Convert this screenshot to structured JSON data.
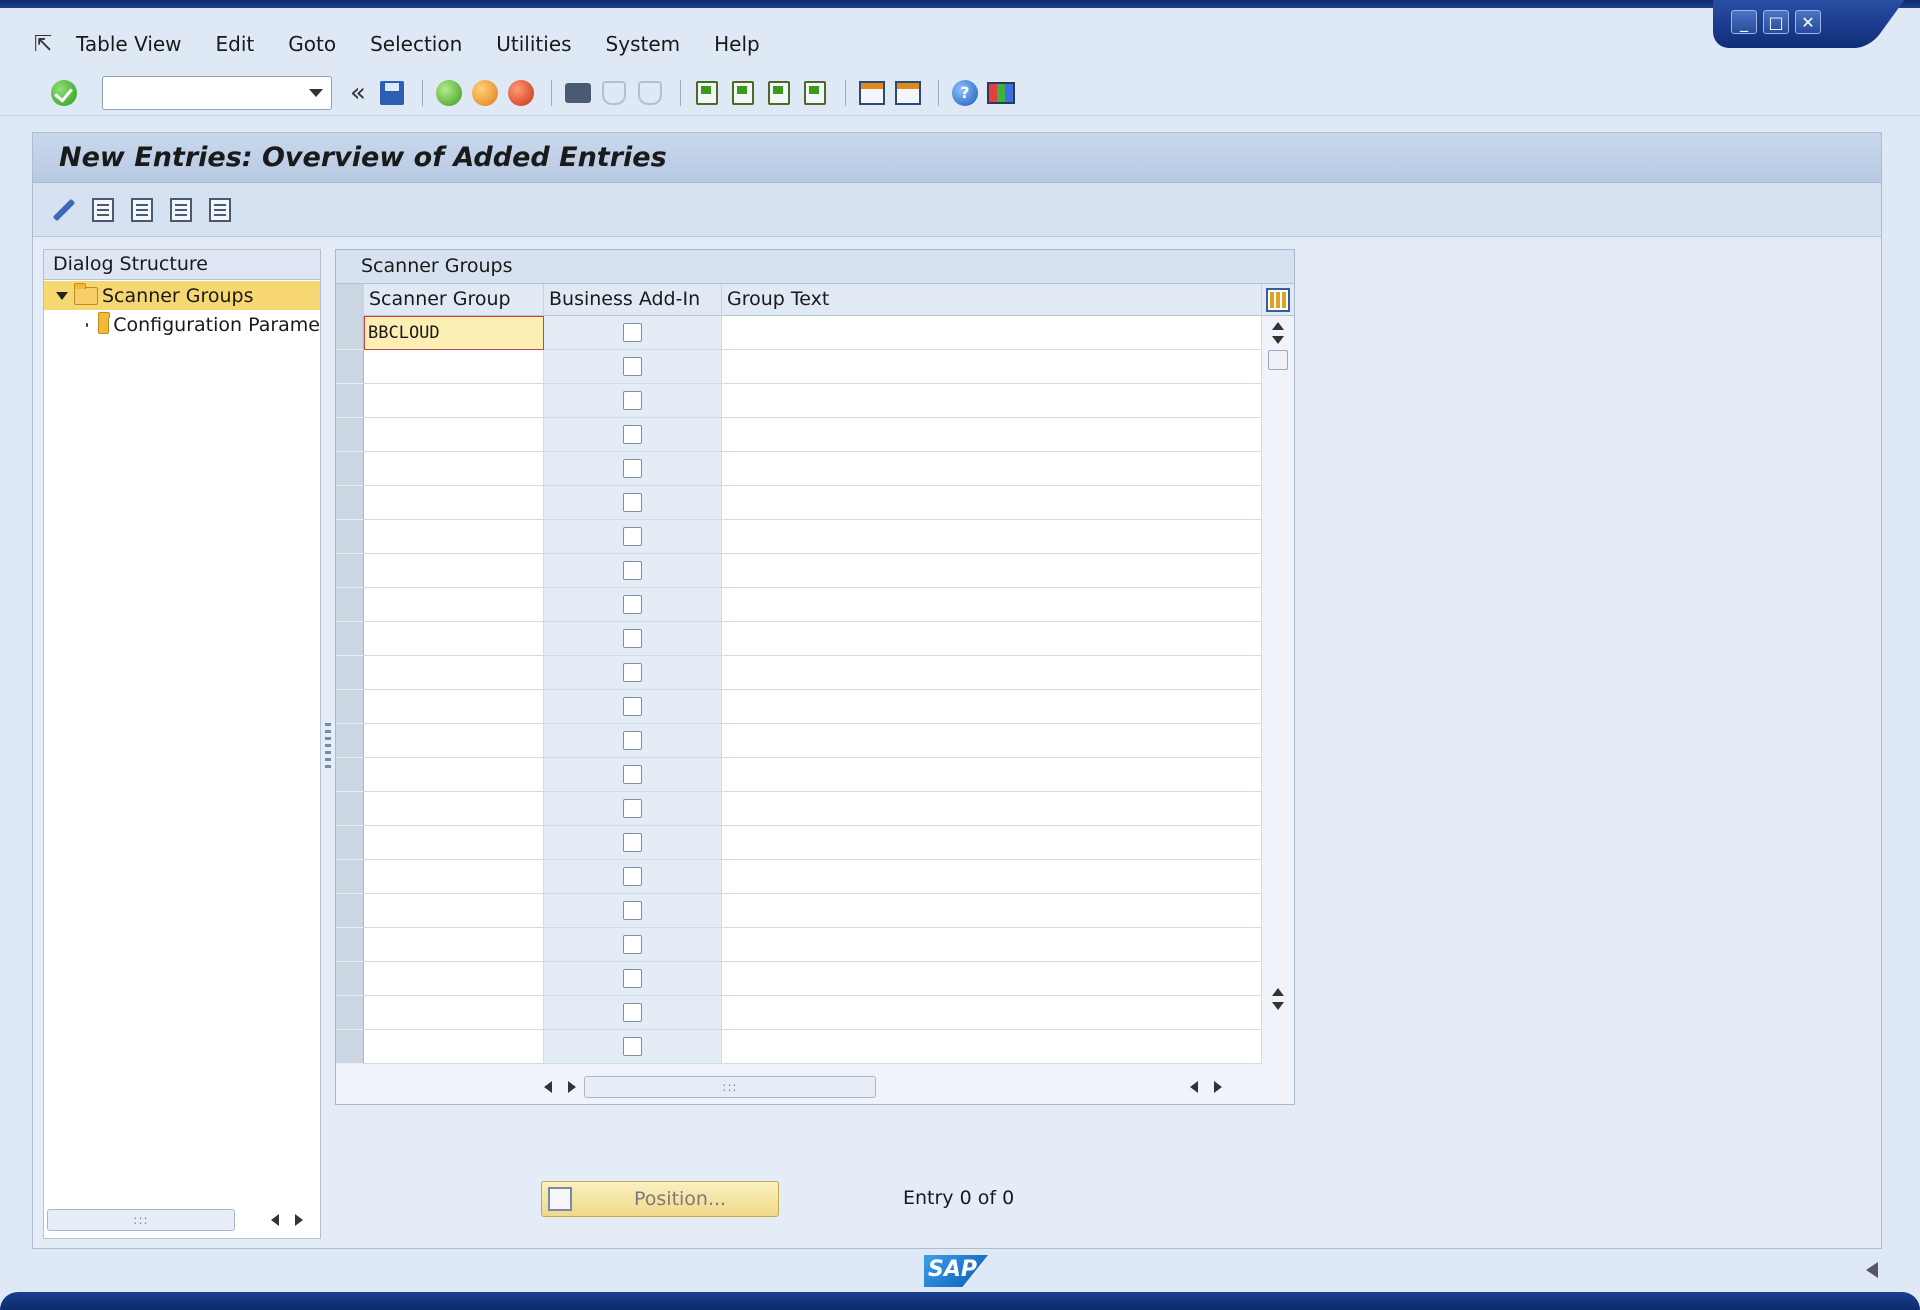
{
  "menu": {
    "items": [
      "Table View",
      "Edit",
      "Goto",
      "Selection",
      "Utilities",
      "System",
      "Help"
    ]
  },
  "window": {
    "minimize": "_",
    "maximize": "□",
    "close": "✕"
  },
  "toolbar": {
    "command_field_value": "",
    "back_chevron": "«"
  },
  "screen": {
    "title": "New Entries: Overview of Added Entries"
  },
  "dialog_structure": {
    "header": "Dialog Structure",
    "nodes": [
      {
        "label": "Scanner Groups",
        "selected": true
      },
      {
        "label": "Configuration Parame",
        "selected": false
      }
    ],
    "scroll_thumb": ":::"
  },
  "table": {
    "title": "Scanner Groups",
    "columns": [
      "Scanner Group",
      "Business Add-In",
      "Group Text"
    ],
    "first_row_value": "BBCLOUD",
    "row_count": 22,
    "scroll_thumb": ":::"
  },
  "footer": {
    "position_button": "Position...",
    "entry_info": "Entry 0 of 0",
    "logo_text": "SAP"
  },
  "colors": {
    "selected_node": "#f6d772",
    "active_cell": "#fcefb4",
    "title_bar": "#c9d8ec"
  }
}
